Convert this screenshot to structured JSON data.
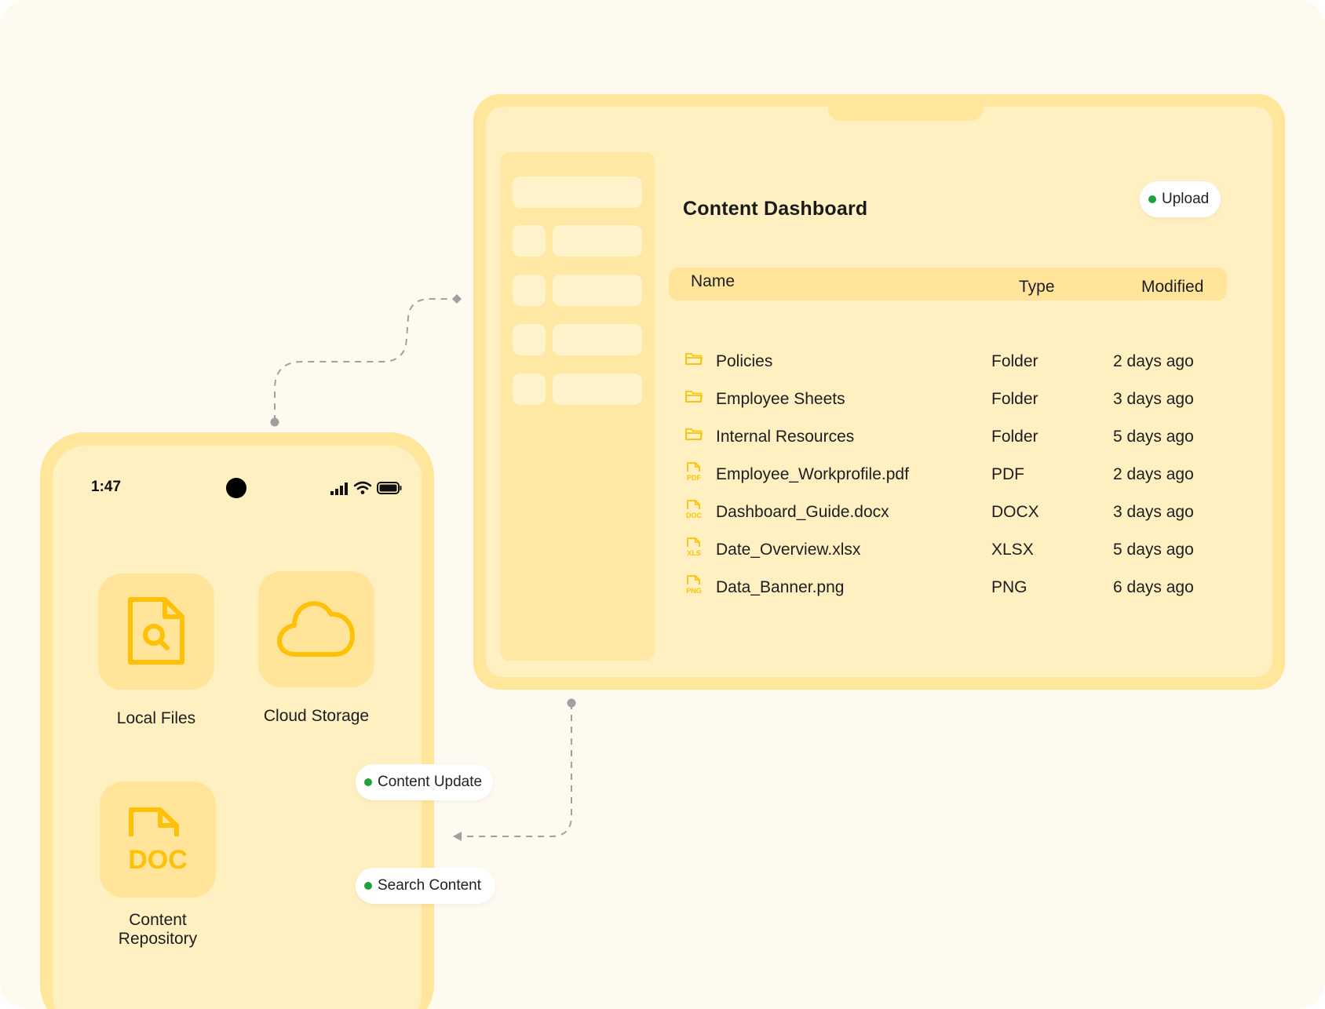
{
  "dashboard": {
    "title": "Content Dashboard",
    "upload_label": "Upload",
    "columns": {
      "name": "Name",
      "type": "Type",
      "modified": "Modified"
    },
    "rows": [
      {
        "icon": "folder-icon",
        "name": "Policies",
        "type": "Folder",
        "modified": "2 days ago"
      },
      {
        "icon": "folder-icon",
        "name": "Employee Sheets",
        "type": "Folder",
        "modified": "3 days ago"
      },
      {
        "icon": "folder-icon",
        "name": "Internal Resources",
        "type": "Folder",
        "modified": "5 days ago"
      },
      {
        "icon": "pdf-file-icon",
        "badge": "PDF",
        "name": "Employee_Workprofile.pdf",
        "type": "PDF",
        "modified": "2 days ago"
      },
      {
        "icon": "doc-file-icon",
        "badge": "DOC",
        "name": "Dashboard_Guide.docx",
        "type": "DOCX",
        "modified": "3 days ago"
      },
      {
        "icon": "xls-file-icon",
        "badge": "XLS",
        "name": "Date_Overview.xlsx",
        "type": "XLSX",
        "modified": "5 days ago"
      },
      {
        "icon": "png-file-icon",
        "badge": "PNG",
        "name": "Data_Banner.png",
        "type": "PNG",
        "modified": "6 days ago"
      }
    ]
  },
  "phone": {
    "time": "1:47",
    "apps": {
      "local_files": "Local Files",
      "cloud_storage": "Cloud Storage",
      "content_repository_line1": "Content",
      "content_repository_line2": "Repository",
      "doc_icon_text": "DOC"
    }
  },
  "chips": {
    "content_update": "Content Update",
    "search_content": "Search Content"
  },
  "colors": {
    "background": "#fefaef",
    "frame": "#ffe69b",
    "surface": "#fff0c2",
    "accent": "#ffc107",
    "status_dot": "#1ea33c",
    "connector": "#a0a0a0"
  }
}
